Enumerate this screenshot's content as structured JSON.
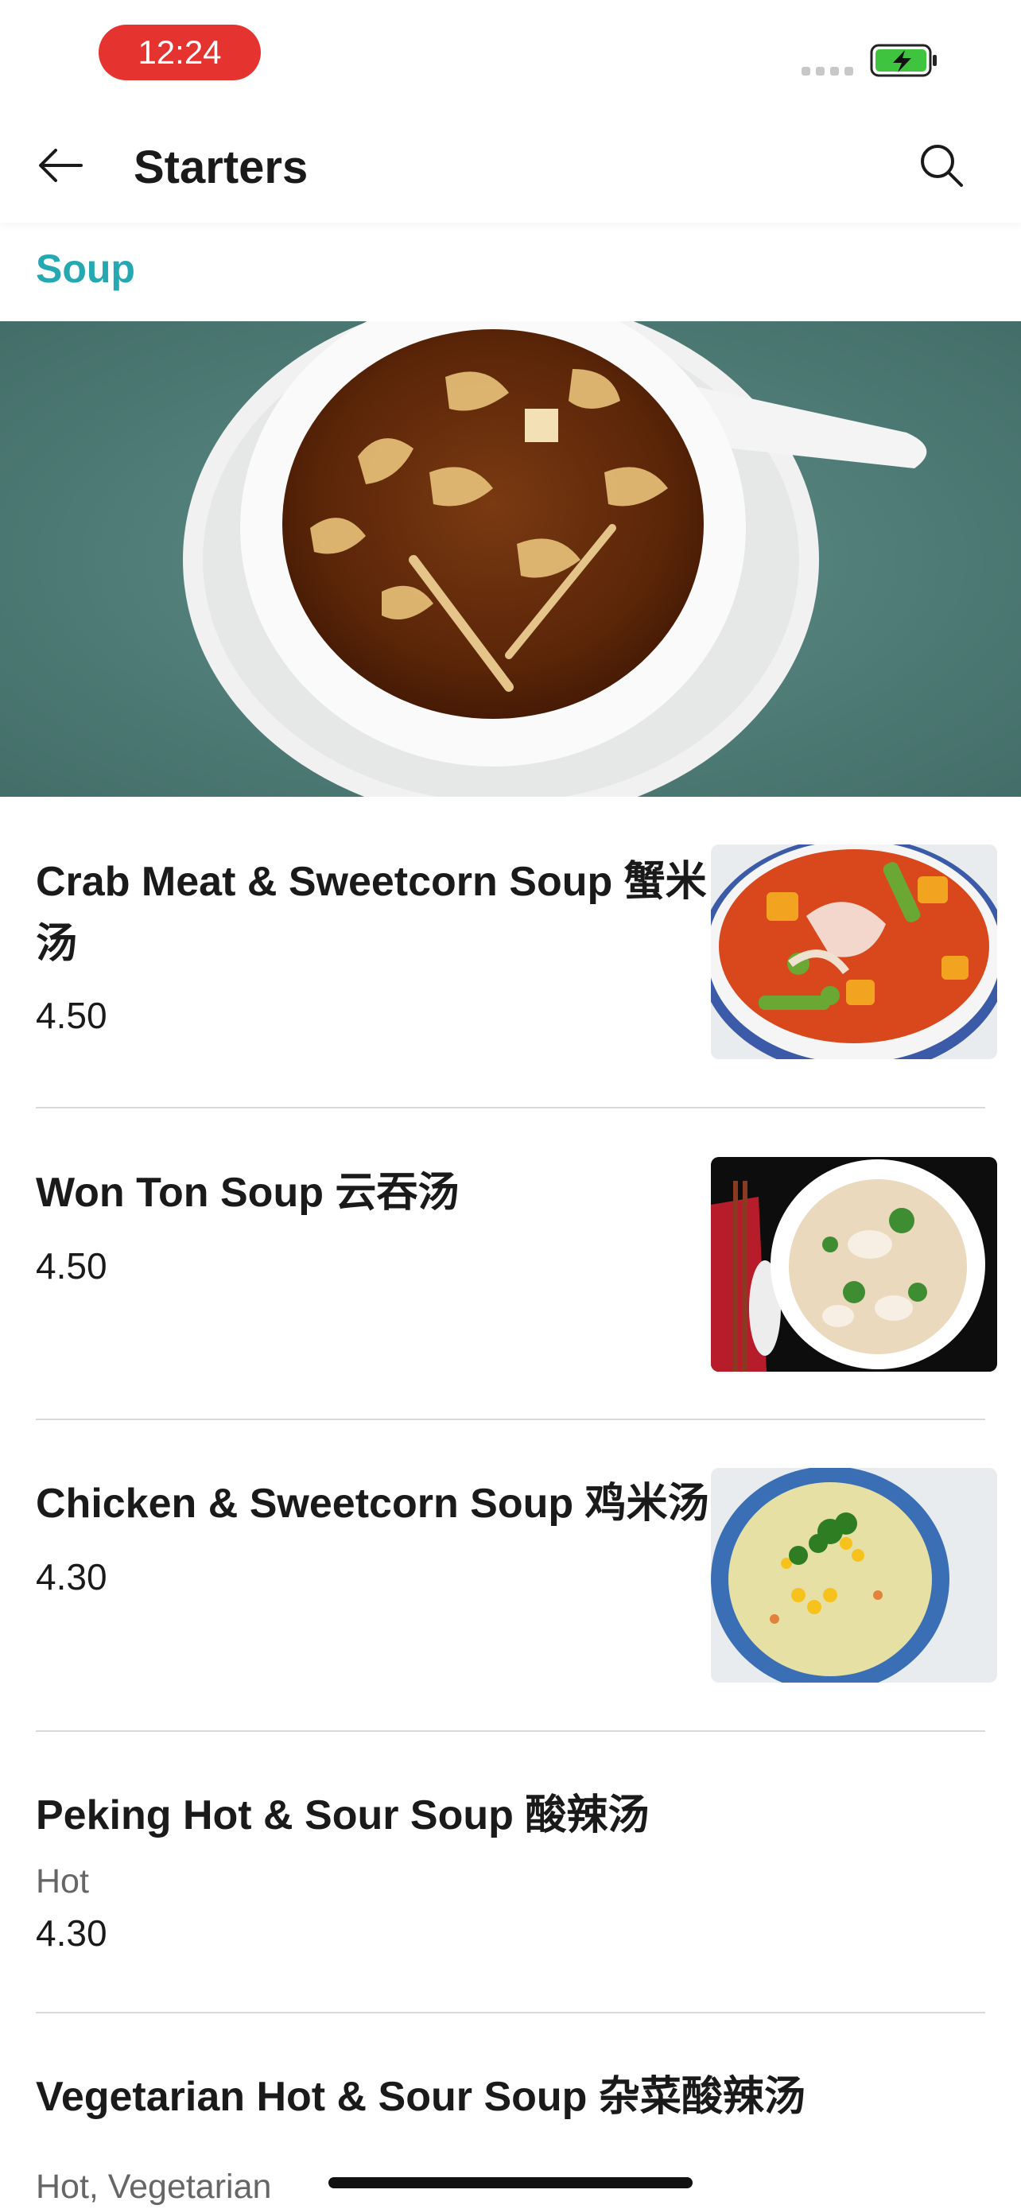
{
  "status_bar": {
    "time": "12:24"
  },
  "header": {
    "title": "Starters"
  },
  "section": {
    "title": "Soup"
  },
  "items": [
    {
      "name": "Crab Meat & Sweetcorn Soup 蟹米汤",
      "price": "4.50"
    },
    {
      "name": "Won Ton Soup 云吞汤",
      "price": "4.50"
    },
    {
      "name": "Chicken & Sweetcorn Soup 鸡米汤",
      "price": "4.30"
    },
    {
      "name": "Peking Hot & Sour Soup 酸辣汤",
      "tags": "Hot",
      "price": "4.30"
    },
    {
      "name": "Vegetarian Hot & Sour Soup 杂菜酸辣汤",
      "tags": "Hot, Vegetarian"
    }
  ],
  "icons": {
    "back": "arrow-left-icon",
    "search": "search-icon",
    "battery": "battery-charging-icon"
  },
  "colors": {
    "accent": "#26a8b2",
    "time_pill": "#e5342f",
    "battery": "#3ec43e"
  }
}
